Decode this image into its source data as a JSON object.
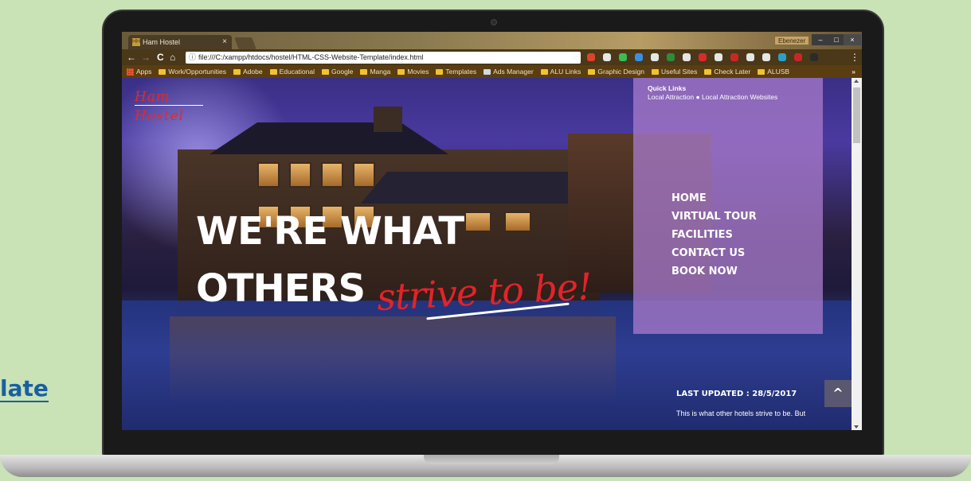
{
  "background_page": {
    "peek_text": "late"
  },
  "browser": {
    "tab_title": "Ham Hostel",
    "tab_close": "×",
    "favicon_text": "HH",
    "user_name": "Ebenezer",
    "window_buttons": [
      "–",
      "□",
      "×"
    ],
    "nav": {
      "back": "←",
      "forward": "→",
      "reload": "C",
      "home": "⌂"
    },
    "address": "file:///C:/xampp/htdocs/hostel/HTML-CSS-Website-Template/index.html",
    "address_info_icon": "ⓘ",
    "bookmark_star": "☆",
    "menu_dots": "⋮",
    "extension_colors": [
      "#d9452b",
      "#e6e6e6",
      "#3dbb55",
      "#3a8ee6",
      "#e6e6e6",
      "#2e8b3a",
      "#e6e6e6",
      "#d92b2b",
      "#e6e6e6",
      "#c62828",
      "#e6e6e6",
      "#e6e6e6",
      "#2aa0c9",
      "#c62828",
      "#2b2b2b"
    ],
    "bookmarks": [
      {
        "label": "Apps",
        "icon": "apps-icon"
      },
      {
        "label": "Work/Opportunities",
        "icon": "folder-icon"
      },
      {
        "label": "Adobe",
        "icon": "folder-icon"
      },
      {
        "label": "Educational",
        "icon": "folder-icon"
      },
      {
        "label": "Google",
        "icon": "folder-icon"
      },
      {
        "label": "Manga",
        "icon": "folder-icon"
      },
      {
        "label": "Movies",
        "icon": "folder-icon"
      },
      {
        "label": "Templates",
        "icon": "folder-icon"
      },
      {
        "label": "Ads Manager",
        "icon": "page-icon"
      },
      {
        "label": "ALU Links",
        "icon": "folder-icon"
      },
      {
        "label": "Graphic Design",
        "icon": "folder-icon"
      },
      {
        "label": "Useful Sites",
        "icon": "folder-icon"
      },
      {
        "label": "Check Later",
        "icon": "folder-icon"
      },
      {
        "label": "ALUSB",
        "icon": "folder-icon"
      }
    ],
    "bookmarks_more": "»"
  },
  "site": {
    "logo": "Ham Hostel",
    "quick_links": {
      "title": "Quick Links",
      "links": "Local Attraction ● Local Attraction Websites"
    },
    "menu": [
      "HOME",
      "VIRTUAL TOUR",
      "FACILITIES",
      "CONTACT US",
      "BOOK NOW"
    ],
    "hero": {
      "line1": "WE'RE WHAT",
      "line2": "OTHERS",
      "script": "strive to be!"
    },
    "last_updated": "LAST UPDATED : 28/5/2017",
    "description": "This is what other hotels strive to be. But",
    "back_to_top": "^"
  }
}
